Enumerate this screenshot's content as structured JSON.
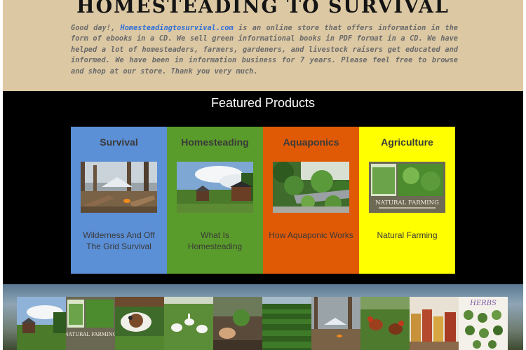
{
  "header": {
    "site_title": "HOMESTEADING TO SURVIVAL",
    "intro_greeting": "Good day!, ",
    "intro_link": "Homesteadingtosurvival.com",
    "intro_rest": " is an online store that offers information in the form of ebooks in a CD. We sell green informational books in PDF format in a CD. We have helped a lot of homesteaders, farmers, gardeners, and livestock raisers get educated and informed. We have been in information business for 7 years. Please feel free to browse and shop at our store. Thank you very much."
  },
  "featured": {
    "title": "Featured Products",
    "cards": [
      {
        "title": "Survival",
        "description": "Wilderness And Off The Grid Survival",
        "bg": "#5b8fd6",
        "text_color": "#3a3a3a"
      },
      {
        "title": "Homesteading",
        "description": "What Is Homesteading",
        "bg": "#5a9c2b",
        "text_color": "#3a3a3a"
      },
      {
        "title": "Aquaponics",
        "description": "How Aquaponic Works",
        "bg": "#e05a06",
        "text_color": "#3a3a3a"
      },
      {
        "title": "Agriculture",
        "description": "Natural Farming",
        "bg": "#ffff00",
        "text_color": "#3a3a3a"
      }
    ],
    "book_cover_text": "NATURAL FARMING"
  },
  "gallery": {
    "cover_text_1": "NATURAL FARMING",
    "herbs_text": "HERBS"
  }
}
